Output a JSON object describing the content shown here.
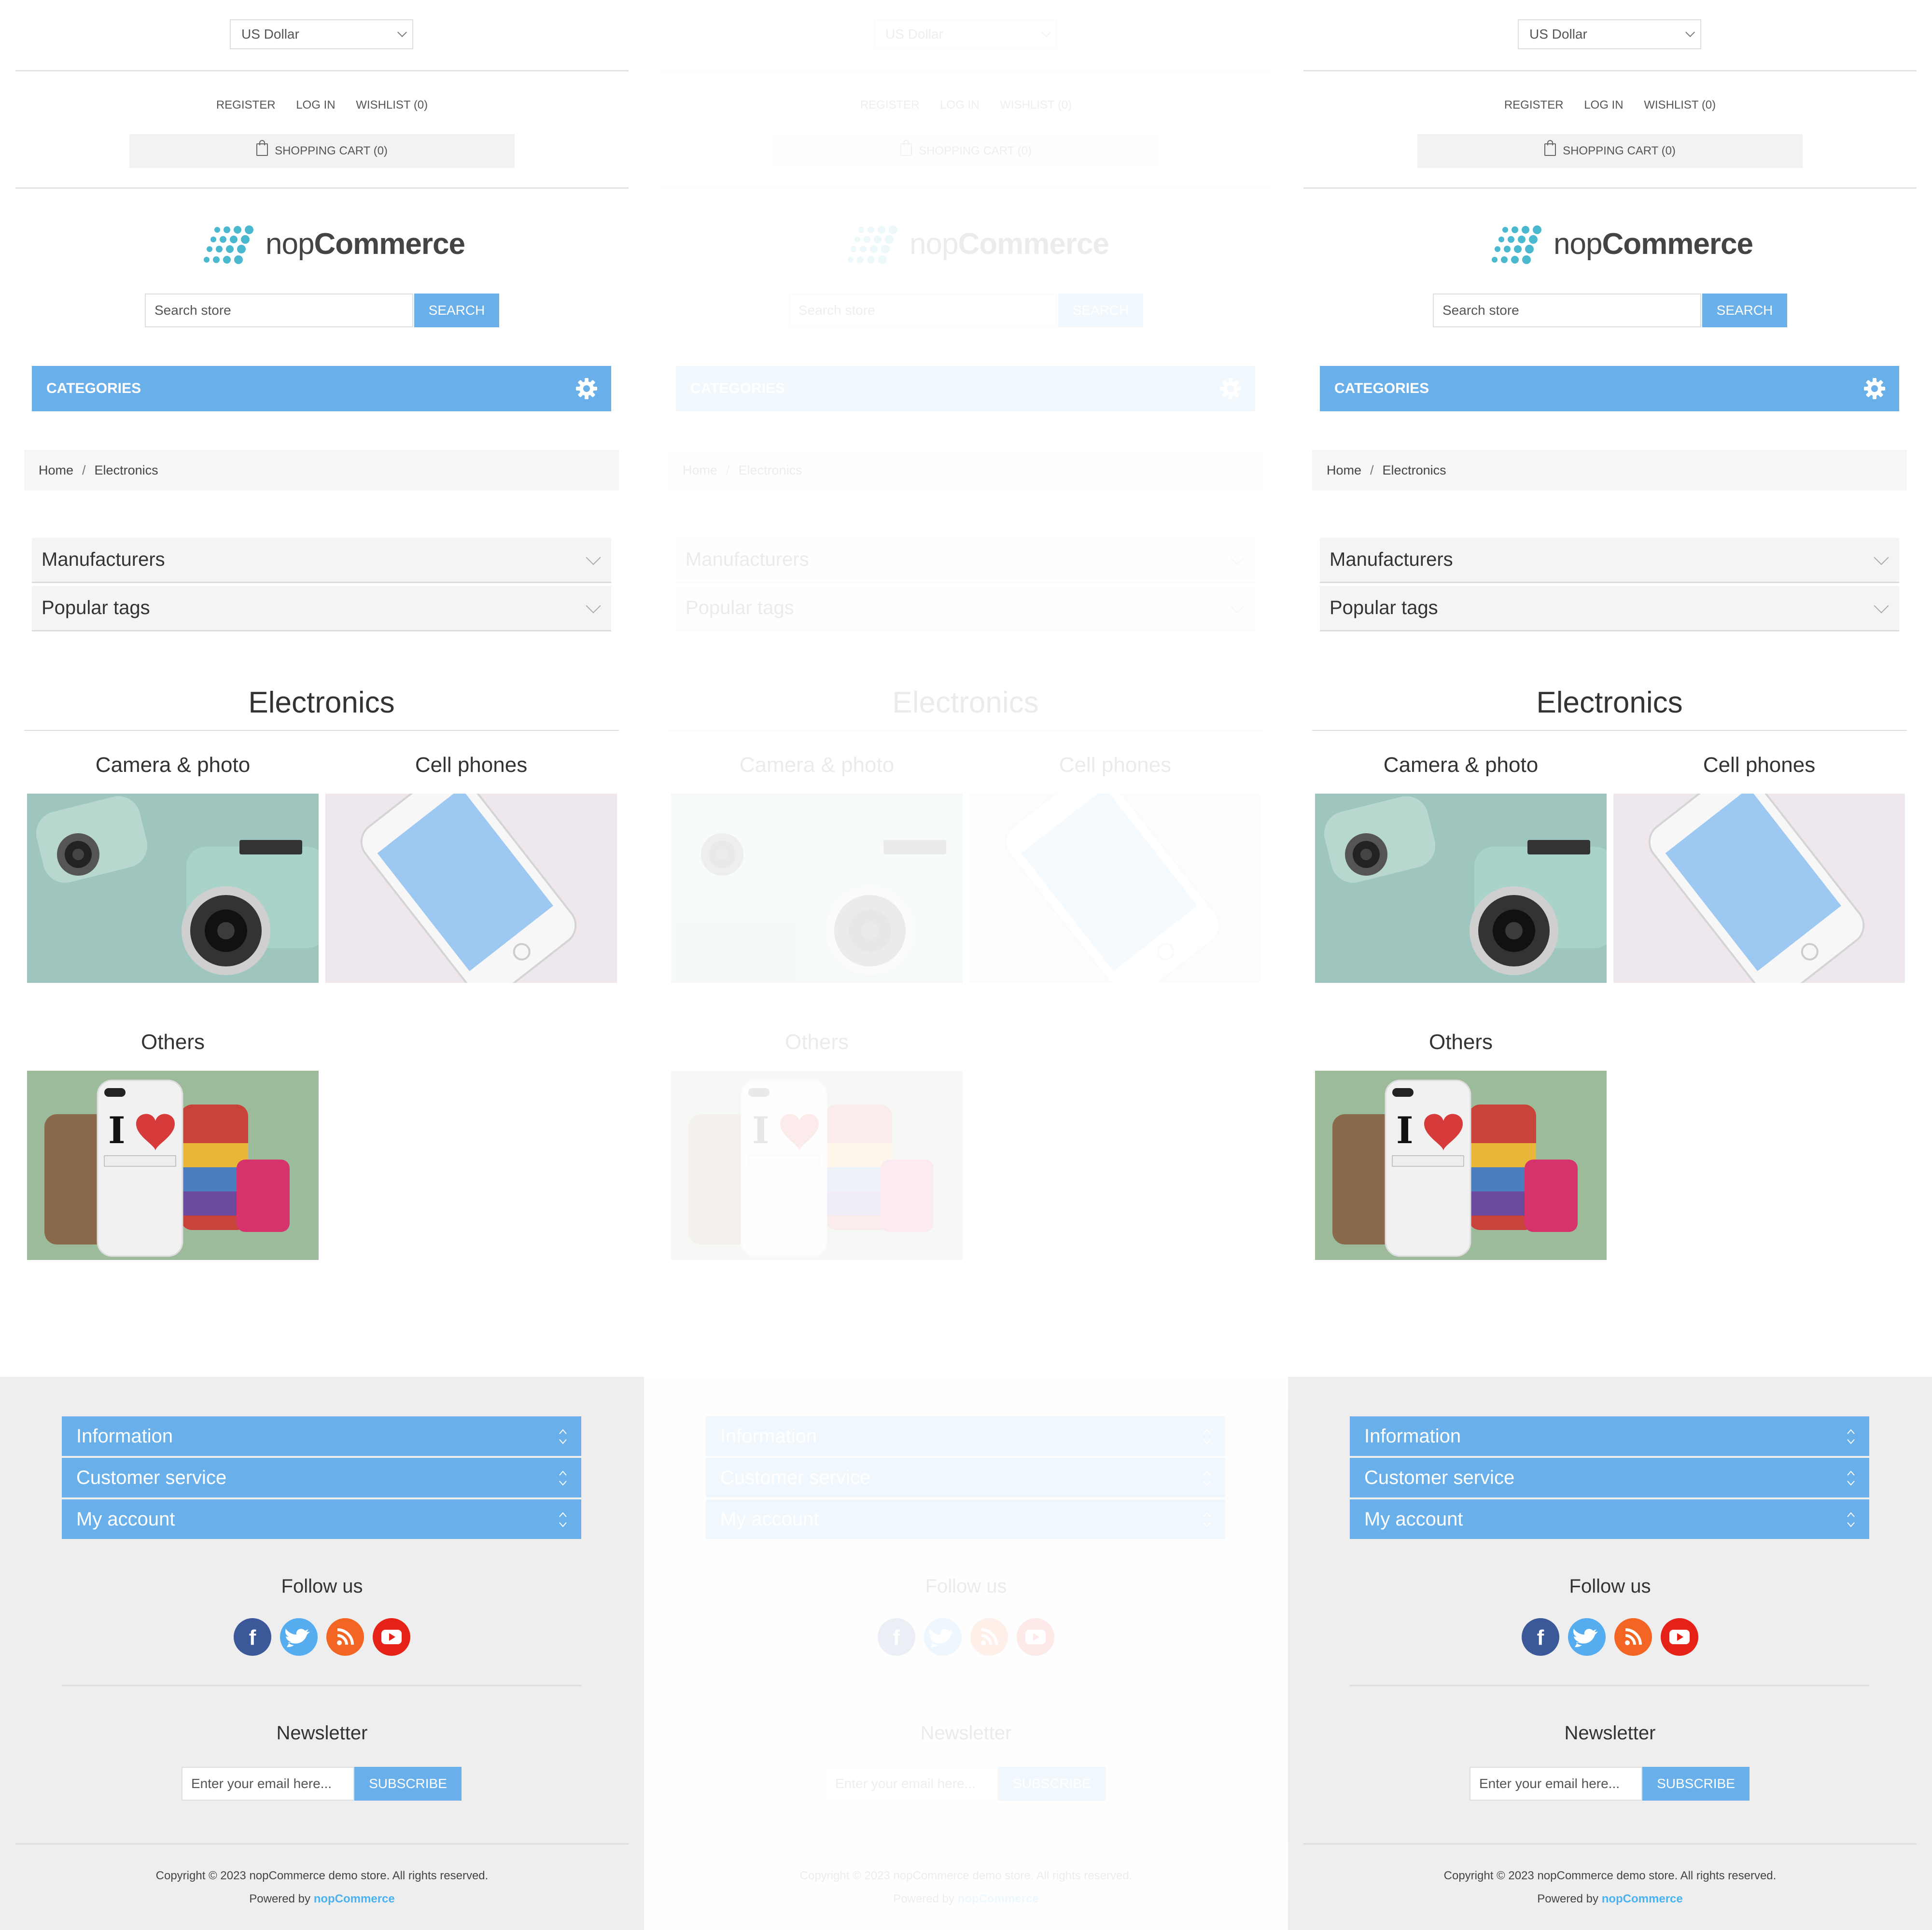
{
  "header": {
    "currency": "US Dollar",
    "links": {
      "register": "REGISTER",
      "login": "LOG IN",
      "wishlist": "WISHLIST (0)"
    },
    "cart": "SHOPPING CART (0)"
  },
  "logo": {
    "light": "nop",
    "bold": "Commerce"
  },
  "search": {
    "placeholder": "Search store",
    "button": "SEARCH"
  },
  "categories": {
    "label": "CATEGORIES"
  },
  "breadcrumb": {
    "home": "Home",
    "separator": "/",
    "current": "Electronics"
  },
  "filters": {
    "manufacturers": "Manufacturers",
    "popular_tags": "Popular tags"
  },
  "page": {
    "title": "Electronics",
    "subcategories": [
      {
        "name": "Camera & photo"
      },
      {
        "name": "Cell phones"
      },
      {
        "name": "Others"
      }
    ]
  },
  "footer": {
    "sections": [
      "Information",
      "Customer service",
      "My account"
    ],
    "follow_us": "Follow us",
    "social": [
      "facebook",
      "twitter",
      "rss",
      "youtube"
    ],
    "newsletter": {
      "title": "Newsletter",
      "placeholder": "Enter your email here...",
      "button": "SUBSCRIBE"
    },
    "copyright": "Copyright © 2023 nopCommerce demo store. All rights reserved.",
    "powered_prefix": "Powered by",
    "powered_brand": "nopCommerce"
  },
  "colors": {
    "accent": "#69b0ea",
    "footer_bg": "#eeeeee",
    "facebook": "#3b5998",
    "twitter": "#55acee",
    "rss": "#f26522",
    "youtube": "#e62117"
  }
}
